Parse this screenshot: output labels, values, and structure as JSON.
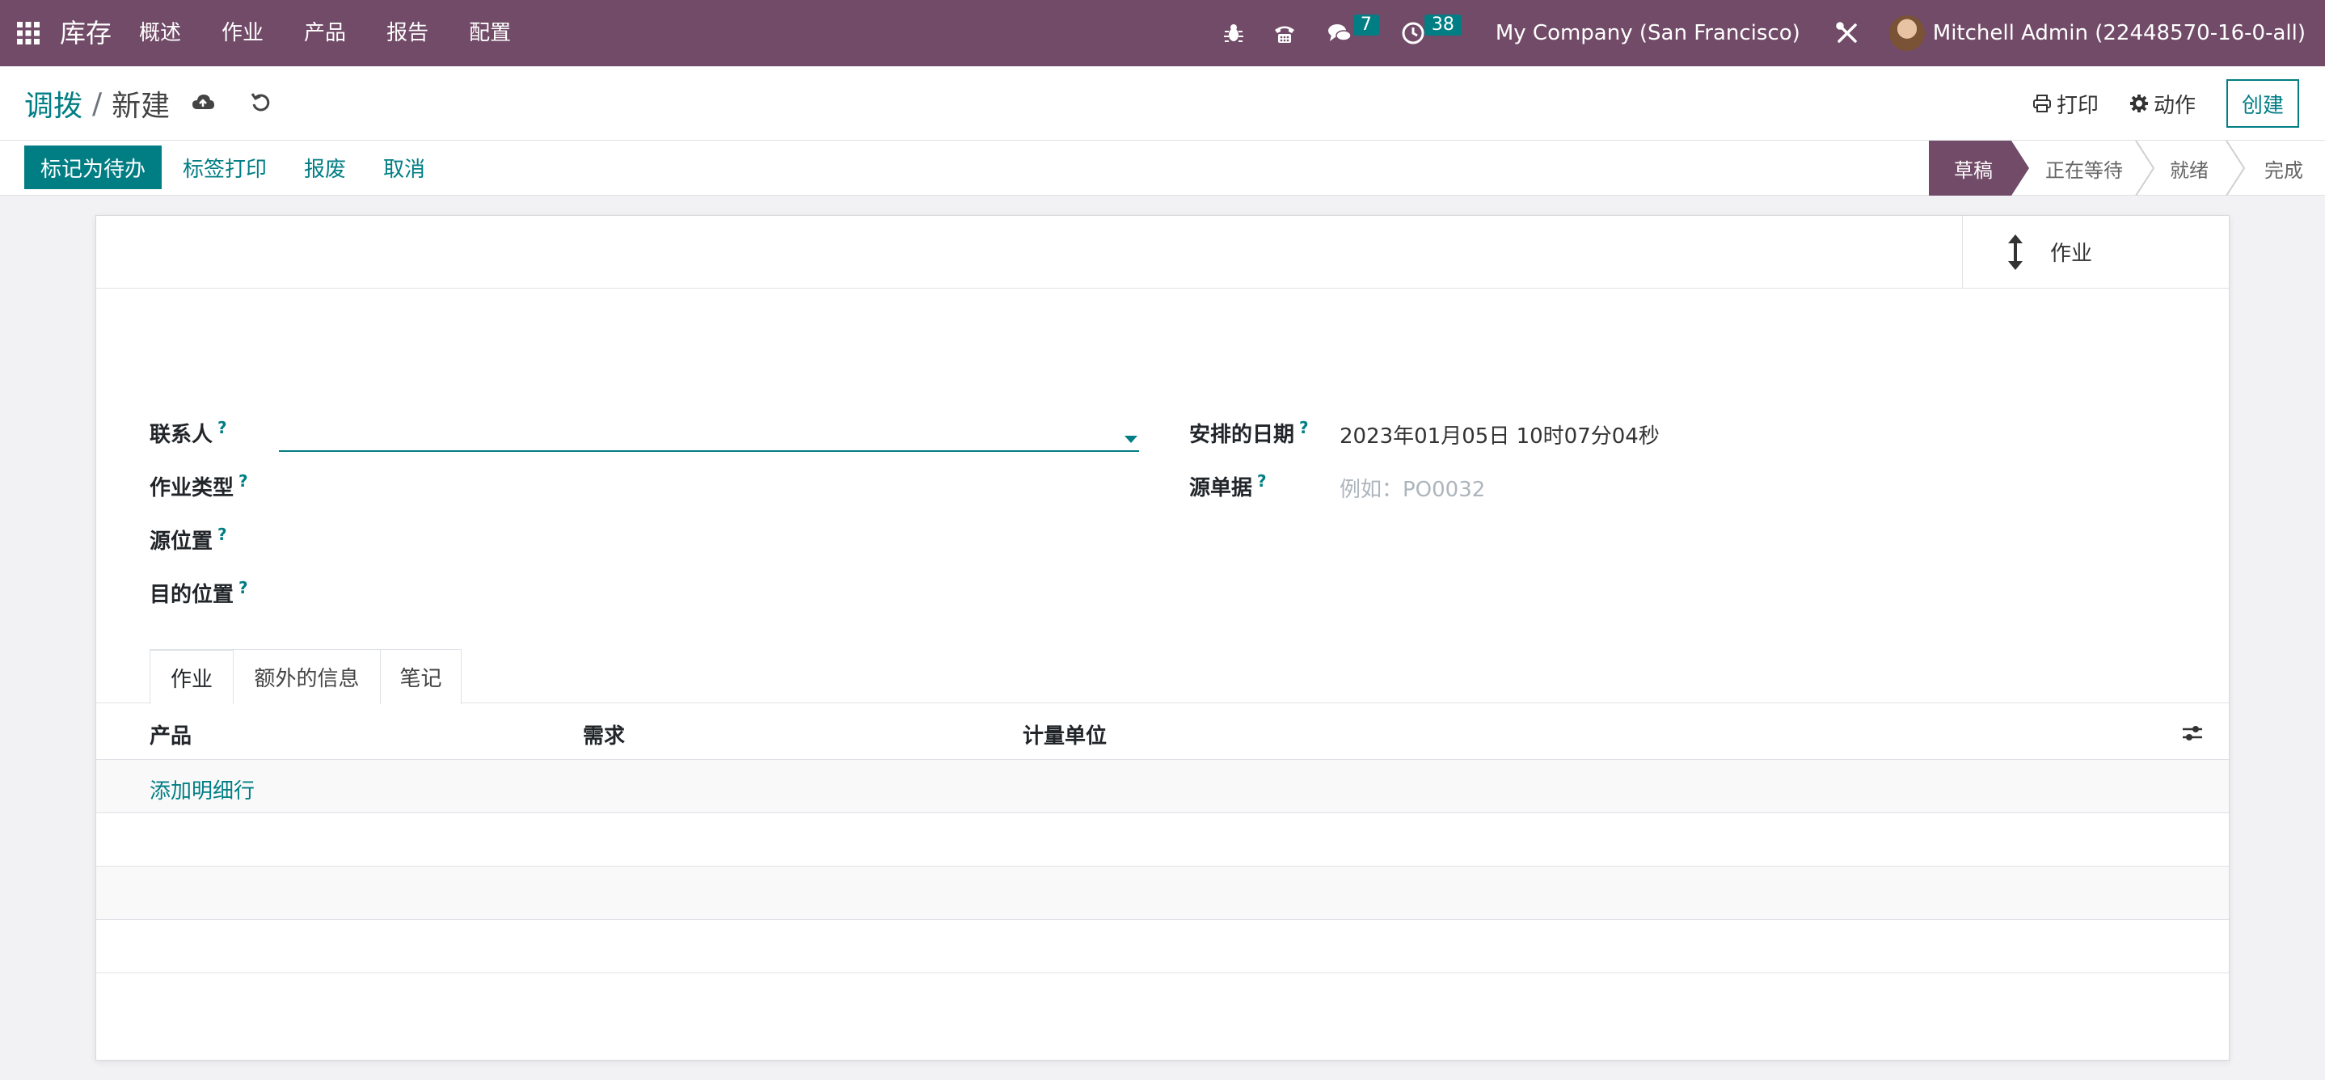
{
  "navbar": {
    "app_name": "库存",
    "menu": [
      "概述",
      "作业",
      "产品",
      "报告",
      "配置"
    ],
    "messages_count": "7",
    "activities_count": "38",
    "company": "My Company (San Francisco)",
    "user": "Mitchell Admin (22448570-16-0-all)"
  },
  "breadcrumb": {
    "parent": "调拨",
    "separator": "/",
    "current": "新建"
  },
  "control": {
    "print": "打印",
    "action": "动作",
    "create": "创建"
  },
  "statusbar": {
    "mark_todo": "标记为待办",
    "print_labels": "标签打印",
    "scrap": "报废",
    "cancel": "取消",
    "stages": [
      {
        "label": "草稿",
        "active": true
      },
      {
        "label": "正在等待",
        "active": false
      },
      {
        "label": "就绪",
        "active": false
      },
      {
        "label": "完成",
        "active": false
      }
    ]
  },
  "smart_button": {
    "label": "作业"
  },
  "form": {
    "partner_label": "联系人",
    "operation_type_label": "作业类型",
    "source_location_label": "源位置",
    "dest_location_label": "目的位置",
    "scheduled_date_label": "安排的日期",
    "scheduled_date_value": "2023年01月05日 10时07分04秒",
    "origin_label": "源单据",
    "origin_placeholder": "例如：PO0032",
    "help_mark": "?"
  },
  "tabs": [
    "作业",
    "额外的信息",
    "笔记"
  ],
  "table": {
    "columns": [
      "产品",
      "需求",
      "计量单位"
    ],
    "add_line": "添加明细行"
  },
  "colors": {
    "brand": "#714b67",
    "accent": "#017e84"
  }
}
